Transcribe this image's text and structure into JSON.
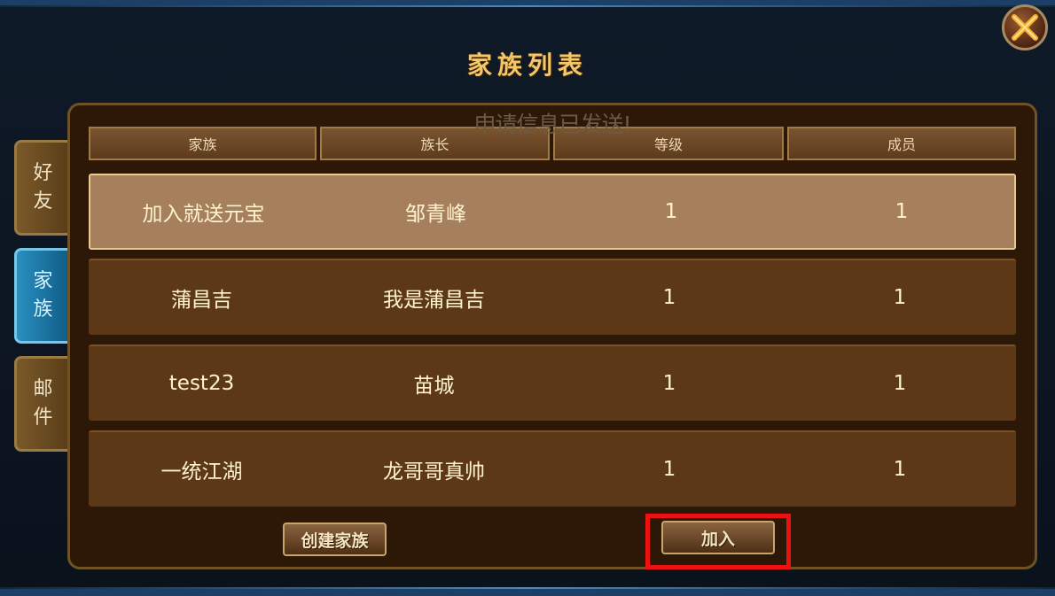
{
  "window": {
    "title": "家族列表"
  },
  "notice": "申请信息已发送!",
  "side_tabs": [
    {
      "label_top": "好",
      "label_bottom": "友",
      "active": false
    },
    {
      "label_top": "家",
      "label_bottom": "族",
      "active": true
    },
    {
      "label_top": "邮",
      "label_bottom": "件",
      "active": false
    }
  ],
  "table": {
    "columns": [
      "家族",
      "族长",
      "等级",
      "成员"
    ],
    "rows": [
      {
        "family": "加入就送元宝",
        "leader": "邹青峰",
        "level": "1",
        "members": "1",
        "selected": true
      },
      {
        "family": "蒲昌吉",
        "leader": "我是蒲昌吉",
        "level": "1",
        "members": "1",
        "selected": false
      },
      {
        "family": "test23",
        "leader": "苗城",
        "level": "1",
        "members": "1",
        "selected": false
      },
      {
        "family": "一统江湖",
        "leader": "龙哥哥真帅",
        "level": "1",
        "members": "1",
        "selected": false
      }
    ]
  },
  "buttons": {
    "create": "创建家族",
    "join": "加入"
  },
  "icons": {
    "close": "close-x-icon"
  },
  "colors": {
    "title": "#f3c86a",
    "highlight": "#ee1111",
    "active_tab": "#2a8fc0"
  }
}
